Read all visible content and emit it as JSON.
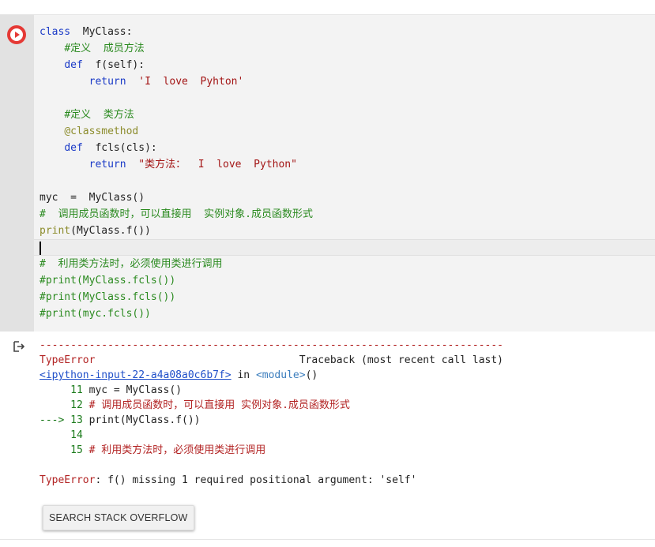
{
  "colors": {
    "run_button": "#e53935",
    "keyword": "#1a3ac7",
    "string": "#a31515",
    "comment": "#2a8a1f",
    "error": "#b22222",
    "link": "#1f4fc9"
  },
  "cell": {
    "run_icon": "play-icon",
    "code": {
      "l1_kw": "class",
      "l1_rest": "  MyClass:",
      "l2_indent": "    ",
      "l2_comment": "#定义  成员方法",
      "l3_indent": "    ",
      "l3_kw": "def",
      "l3_rest": "  f(self):",
      "l4_indent": "        ",
      "l4_kw": "return",
      "l4_str": "  'I  love  Pyhton'",
      "l5": "",
      "l6_indent": "    ",
      "l6_comment": "#定义  类方法",
      "l7_indent": "    ",
      "l7_dec": "@classmethod",
      "l8_indent": "    ",
      "l8_kw": "def",
      "l8_rest": "  fcls(cls):",
      "l9_indent": "        ",
      "l9_kw": "return",
      "l9_str": "  \"类方法：  I  love  Python\"",
      "l10": "",
      "l11": "myc  =  MyClass()",
      "l12_comment": "#  调用成员函数时，可以直接用  实例对象.成员函数形式",
      "l13_kw": "print",
      "l13_rest": "(MyClass.f())",
      "l14": "",
      "l15_comment": "#  利用类方法时，必须使用类进行调用",
      "l16_comment": "#print(MyClass.fcls())",
      "l17_comment": "#print(MyClass.fcls())",
      "l18_comment": "#print(myc.fcls())"
    }
  },
  "output": {
    "icon": "output-arrow-icon",
    "dashes": "---------------------------------------------------------------------------",
    "err_type": "TypeError",
    "traceback_label": "                                 Traceback (most recent call last)",
    "input_link": "<ipython-input-22-a4a08a0c6b7f>",
    "in_text": " in ",
    "module_text": "<module>",
    "module_paren": "()",
    "t1_num": "     11",
    "t1_code": " myc = MyClass()",
    "t2_num": "     12",
    "t2_code": " # 调用成员函数时，可以直接用 实例对象.成员函数形式",
    "t3_arrow": "---> 13",
    "t3_code": " print(MyClass.f())",
    "t4_num": "     14",
    "t5_num": "     15",
    "t5_code": " # 利用类方法时，必须使用类进行调用",
    "final_err_type": "TypeError",
    "final_err_msg": ": f() missing 1 required positional argument: 'self'"
  },
  "search_button_label": "SEARCH STACK OVERFLOW"
}
